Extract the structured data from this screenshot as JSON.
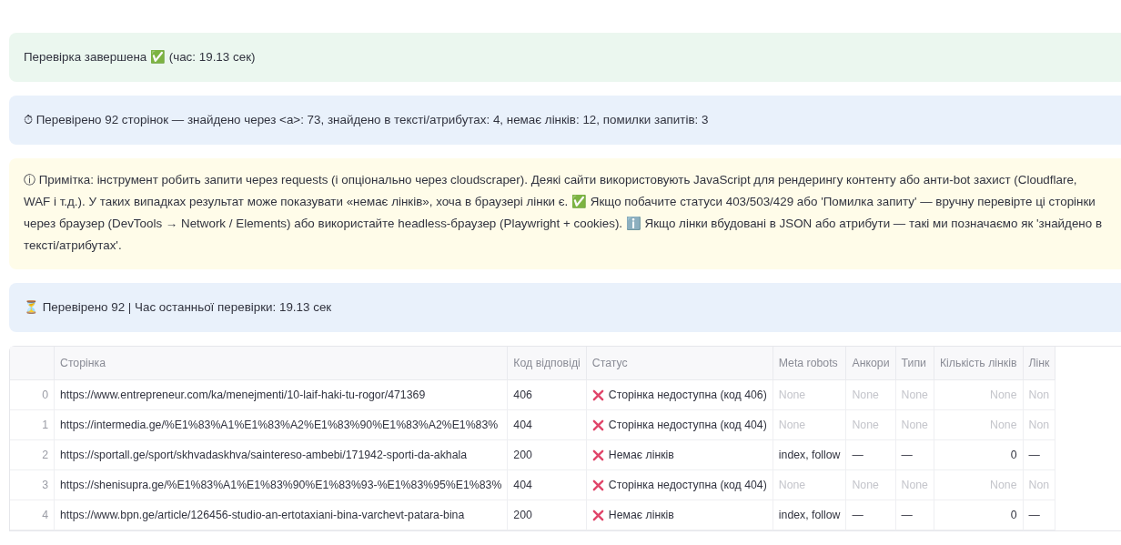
{
  "alerts": [
    {
      "kind": "success",
      "text": "Перевірка завершена ✅ (час: 19.13 сек)"
    },
    {
      "kind": "info",
      "text": "⏱ Перевірено 92 сторінок — знайдено через <a>: 73, знайдено в тексті/атрибутах: 4, немає лінків: 12, помилки запитів: 3"
    },
    {
      "kind": "warning",
      "text": "ⓘ Примітка: інструмент робить запити через requests (і опціонально через cloudscraper). Деякі сайти використовують JavaScript для рендерингу контенту або анти-bot захист (Cloudflare, WAF і т.д.). У таких випадках результат може показувати «немає лінків», хоча в браузері лінки є. ✅ Якщо побачите статуси 403/503/429 або 'Помилка запиту' — вручну перевірте ці сторінки через браузер (DevTools → Network / Elements) або використайте headless-браузер (Playwright + cookies). ℹ️ Якщо лінки вбудовані в JSON або атрибути — такі ми позначаємо як 'знайдено в тексті/атрибутах'."
    },
    {
      "kind": "info",
      "text": "⏳ Перевірено 92 | Час останньої перевірки: 19.13 сек"
    }
  ],
  "table": {
    "columns": [
      "Сторінка",
      "Код відповіді",
      "Статус",
      "Meta robots",
      "Анкори",
      "Типи",
      "Кількість лінків",
      "Лінк"
    ],
    "rows": [
      {
        "index": "0",
        "page": "https://www.entrepreneur.com/ka/menejmenti/10-laif-haki-tu-rogor/471369",
        "code": "406",
        "status": {
          "kind": "error",
          "text": "Сторінка недоступна (код 406)"
        },
        "meta": {
          "text": "None",
          "muted": true
        },
        "anchors": {
          "text": "None",
          "muted": true
        },
        "types": {
          "text": "None",
          "muted": true
        },
        "count": {
          "text": "None",
          "muted": true
        },
        "links": {
          "text": "Non",
          "muted": true
        }
      },
      {
        "index": "1",
        "page": "https://intermedia.ge/%E1%83%A1%E1%83%A2%E1%83%90%E1%83%A2%E1%83%",
        "code": "404",
        "status": {
          "kind": "error",
          "text": "Сторінка недоступна (код 404)"
        },
        "meta": {
          "text": "None",
          "muted": true
        },
        "anchors": {
          "text": "None",
          "muted": true
        },
        "types": {
          "text": "None",
          "muted": true
        },
        "count": {
          "text": "None",
          "muted": true
        },
        "links": {
          "text": "Non",
          "muted": true
        }
      },
      {
        "index": "2",
        "page": "https://sportall.ge/sport/skhvadaskhva/saintereso-ambebi/171942-sporti-da-akhala",
        "code": "200",
        "status": {
          "kind": "error",
          "text": "Немає лінків"
        },
        "meta": {
          "text": "index, follow",
          "muted": false
        },
        "anchors": {
          "text": "—",
          "muted": false
        },
        "types": {
          "text": "—",
          "muted": false
        },
        "count": {
          "text": "0",
          "muted": false
        },
        "links": {
          "text": "—",
          "muted": false
        }
      },
      {
        "index": "3",
        "page": "https://shenisupra.ge/%E1%83%A1%E1%83%90%E1%83%93-%E1%83%95%E1%83%",
        "code": "404",
        "status": {
          "kind": "error",
          "text": "Сторінка недоступна (код 404)"
        },
        "meta": {
          "text": "None",
          "muted": true
        },
        "anchors": {
          "text": "None",
          "muted": true
        },
        "types": {
          "text": "None",
          "muted": true
        },
        "count": {
          "text": "None",
          "muted": true
        },
        "links": {
          "text": "Non",
          "muted": true
        }
      },
      {
        "index": "4",
        "page": "https://www.bpn.ge/article/126456-studio-an-ertotaxiani-bina-varchevt-patara-bina",
        "code": "200",
        "status": {
          "kind": "error",
          "text": "Немає лінків"
        },
        "meta": {
          "text": "index, follow",
          "muted": false
        },
        "anchors": {
          "text": "—",
          "muted": false
        },
        "types": {
          "text": "—",
          "muted": false
        },
        "count": {
          "text": "0",
          "muted": false
        },
        "links": {
          "text": "—",
          "muted": false
        }
      }
    ]
  }
}
